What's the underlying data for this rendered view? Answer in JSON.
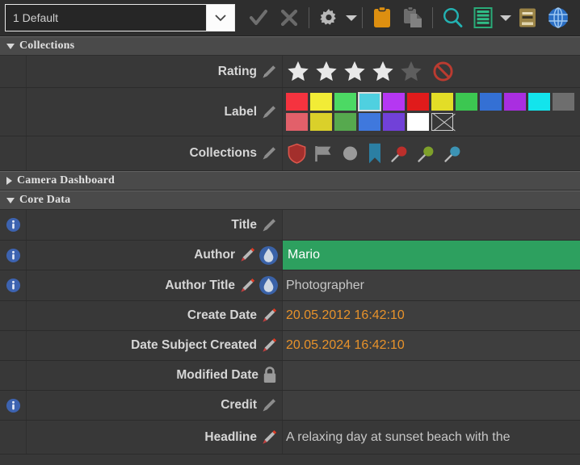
{
  "toolbar": {
    "preset_value": "1 Default",
    "dropdown_icon": "chevron-down-icon",
    "buttons": [
      {
        "name": "apply-check-button",
        "icon": "check-icon"
      },
      {
        "name": "cancel-x-button",
        "icon": "close-x-icon"
      },
      {
        "name": "settings-button",
        "icon": "gear-icon"
      },
      {
        "name": "settings-dropdown",
        "icon": "caret-down-icon"
      },
      {
        "name": "copy-metadata-button",
        "icon": "clipboard-icon"
      },
      {
        "name": "paste-metadata-button",
        "icon": "paste-icon"
      },
      {
        "name": "search-button",
        "icon": "search-icon"
      },
      {
        "name": "list-view-button",
        "icon": "list-icon"
      },
      {
        "name": "list-view-dropdown",
        "icon": "caret-down-icon"
      },
      {
        "name": "dictionary-button",
        "icon": "book-icon"
      },
      {
        "name": "web-button",
        "icon": "globe-icon"
      }
    ]
  },
  "sections": {
    "collections": {
      "label": "Collections",
      "expanded": true,
      "arrow": "triangle-down-icon"
    },
    "camera_dashboard": {
      "label": "Camera Dashboard",
      "expanded": false,
      "arrow": "triangle-right-icon"
    },
    "core_data": {
      "label": "Core Data",
      "expanded": true,
      "arrow": "triangle-down-icon"
    }
  },
  "collections_rows": {
    "rating": {
      "label": "Rating",
      "edit_icon": "pencil-icon",
      "stars_total": 5,
      "stars_filled": 4,
      "star_filled_color": "#e8e8e8",
      "star_empty_color": "#5e5e5e",
      "reject_icon": "no-entry-icon",
      "reject_color": "#c0392b"
    },
    "label": {
      "label": "Label",
      "edit_icon": "pencil-icon",
      "selected_index": 3,
      "row1_colors": [
        "#f5333f",
        "#f2ec36",
        "#4cd964",
        "#4fd0e0",
        "#b537f2",
        "#e01b1b",
        "#e3dd27",
        "#3cc751",
        "#3470d4",
        "#a92ee0",
        "#13e4ec",
        "#6e6e6e"
      ],
      "row2_colors": [
        "#e2606a",
        "#dad02a",
        "#56a94e",
        "#3f78dd",
        "#7141d8",
        "#ffffff"
      ],
      "row2_none": "no-label-swatch"
    },
    "collections": {
      "label": "Collections",
      "edit_icon": "pencil-icon",
      "icons": [
        {
          "name": "shield-icon",
          "color": "#b4322f"
        },
        {
          "name": "flag-icon",
          "color": "#909090"
        },
        {
          "name": "circle-icon",
          "color": "#9a9a9a"
        },
        {
          "name": "bookmark-icon",
          "color": "#2f7fa0"
        },
        {
          "name": "pin-red-icon",
          "color": "#c0392b"
        },
        {
          "name": "pin-green-icon",
          "color": "#7aa22a"
        },
        {
          "name": "pin-blue-icon",
          "color": "#3d93b5"
        }
      ]
    }
  },
  "core_data_rows": [
    {
      "label": "Title",
      "value": "",
      "value_color": "default",
      "info": true,
      "icons": [
        "pencil-gray-icon"
      ],
      "highlight": false,
      "inset": true
    },
    {
      "label": "Author",
      "value": "Mario",
      "value_color": "white",
      "info": true,
      "icons": [
        "pencil-red-icon",
        "droplet-icon"
      ],
      "highlight": true,
      "inset": false
    },
    {
      "label": "Author Title",
      "value": "Photographer",
      "value_color": "default",
      "info": true,
      "icons": [
        "pencil-red-icon",
        "droplet-icon"
      ],
      "highlight": false,
      "inset": true
    },
    {
      "label": "Create Date",
      "value": "20.05.2012 16:42:10",
      "value_color": "orange",
      "info": false,
      "icons": [
        "pencil-red-icon"
      ],
      "highlight": false,
      "inset": true
    },
    {
      "label": "Date Subject Created",
      "value": "20.05.2024 16:42:10",
      "value_color": "orange",
      "info": false,
      "icons": [
        "pencil-red-icon"
      ],
      "highlight": false,
      "inset": true
    },
    {
      "label": "Modified Date",
      "value": "",
      "value_color": "default",
      "info": false,
      "icons": [
        "lock-icon"
      ],
      "highlight": false,
      "inset": true
    },
    {
      "label": "Credit",
      "value": "",
      "value_color": "default",
      "info": true,
      "icons": [
        "pencil-gray-icon"
      ],
      "highlight": false,
      "inset": true
    },
    {
      "label": "Headline",
      "value": "A relaxing day at sunset beach with the",
      "value_color": "default",
      "info": false,
      "icons": [
        "pencil-red-icon"
      ],
      "highlight": false,
      "inset": false
    }
  ]
}
